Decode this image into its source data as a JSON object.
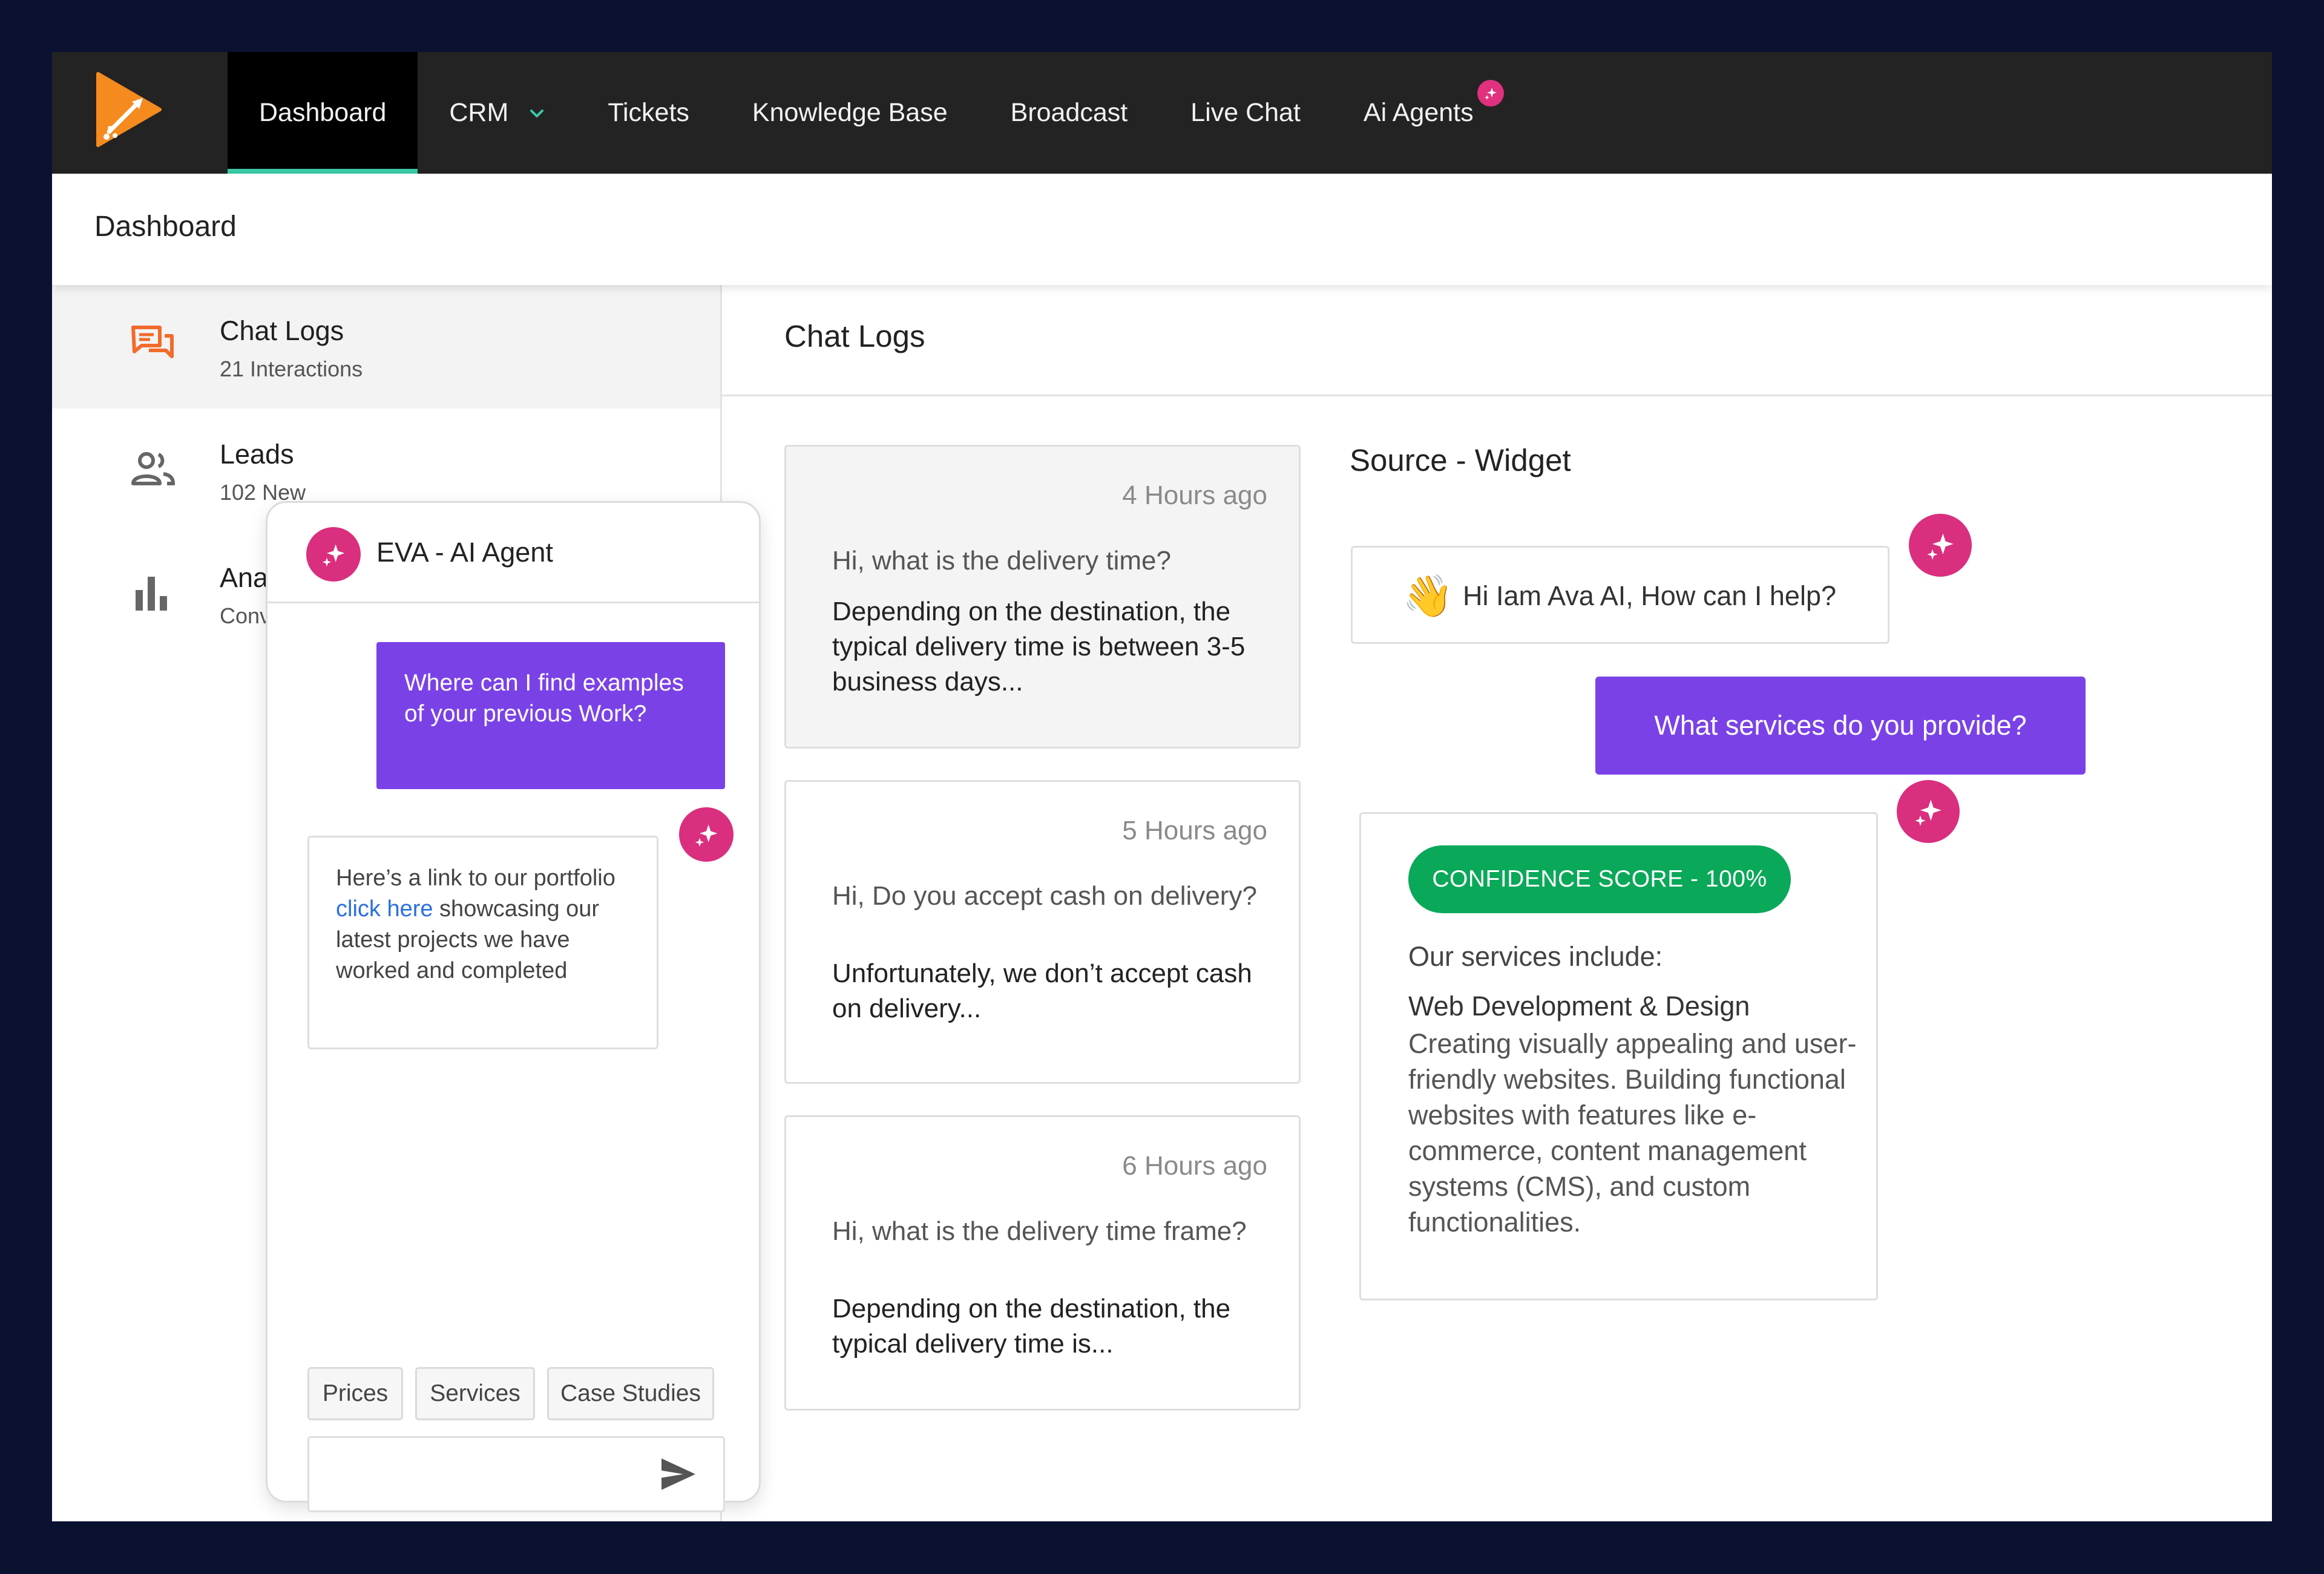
{
  "nav": {
    "items": [
      {
        "label": "Dashboard",
        "active": true
      },
      {
        "label": "CRM",
        "has_dropdown": true
      },
      {
        "label": "Tickets"
      },
      {
        "label": "Knowledge Base"
      },
      {
        "label": "Broadcast"
      },
      {
        "label": "Live Chat"
      },
      {
        "label": "Ai Agents",
        "badge_icon": "sparkle-icon"
      }
    ]
  },
  "page": {
    "title": "Dashboard"
  },
  "sidebar": {
    "items": [
      {
        "title": "Chat Logs",
        "subtitle": "21 Interactions",
        "icon": "chat-bubbles-icon",
        "active": true
      },
      {
        "title": "Leads",
        "subtitle": "102 New",
        "icon": "people-icon"
      },
      {
        "title": "Analytics",
        "subtitle": "Conversions",
        "icon": "bar-chart-icon"
      }
    ]
  },
  "main": {
    "title": "Chat Logs",
    "logs": [
      {
        "time": "4 Hours ago",
        "question": "Hi, what is the delivery time?",
        "answer": "Depending on the destination, the typical delivery time is between 3-5 business days..."
      },
      {
        "time": "5 Hours ago",
        "question": "Hi, Do you accept cash on delivery?",
        "answer": "Unfortunately, we don’t accept cash on delivery..."
      },
      {
        "time": "6 Hours ago",
        "question": "Hi, what is the delivery time frame?",
        "answer": "Depending on the destination, the typical delivery time is..."
      }
    ]
  },
  "source": {
    "title": "Source - Widget",
    "greeting_emoji": "👋",
    "greeting": "Hi Iam Ava AI, How can I help?",
    "user_message": "What services do you provide?",
    "confidence": "CONFIDENCE SCORE - 100%",
    "answer_heading": "Our services include:",
    "answer_subheading": "Web Development & Design",
    "answer_body": "Creating visually appealing and user-friendly websites. Building functional websites with features like e-commerce, content management systems (CMS), and custom functionalities."
  },
  "agent": {
    "name": "EVA - AI Agent",
    "user_message": "Where can I find examples of your previous Work?",
    "reply_before": "Here’s a link to our portfolio ",
    "reply_link": "click here",
    "reply_after": " showcasing our latest projects we have worked and completed",
    "chips": [
      "Prices",
      "Services",
      "Case Studies"
    ],
    "input_placeholder": ""
  },
  "colors": {
    "accent_purple": "#7a42e6",
    "ai_pink": "#d92f7e",
    "confidence_green": "#0aa859",
    "active_tab_underline": "#3bc9a8",
    "logo_orange": "#f58a1f"
  }
}
